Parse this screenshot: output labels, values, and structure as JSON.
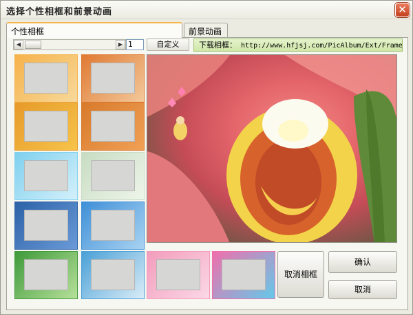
{
  "window": {
    "title": "选择个性相框和前景动画",
    "close_glyph": "✕"
  },
  "tabs": [
    {
      "label": "个性相框"
    },
    {
      "label": "前景动画"
    }
  ],
  "toolbar": {
    "scroll_left_glyph": "◀",
    "scroll_right_glyph": "▶",
    "page_value": "1",
    "custom_label": "自定义",
    "download_label": "下载相框：",
    "download_url": "http://www.hfjsj.com/PicAlbum/Ext/Frame.htm"
  },
  "thumbnails": [
    {
      "name": "orange-floral-frame",
      "border": "#f6b24a",
      "inner": "#f7d99b"
    },
    {
      "name": "orange-cartoon-frame",
      "border": "#e07a33",
      "inner": "#f3c89a"
    },
    {
      "name": "autumn-leaves-frame",
      "border": "#e69a2a",
      "inner": "#f7c44a"
    },
    {
      "name": "autumn-tree-frame",
      "border": "#d87a2c",
      "inner": "#f0a055"
    },
    {
      "name": "light-blue-frame",
      "border": "#7fd0ee",
      "inner": "#d4f0fb"
    },
    {
      "name": "birthday-kids-frame",
      "border": "#c7dcc2",
      "inner": "#eef5ea"
    },
    {
      "name": "night-sky-frame",
      "border": "#2d62a8",
      "inner": "#6a9ad7"
    },
    {
      "name": "blue-sky-frame",
      "border": "#3f8fd7",
      "inner": "#a8d3f2"
    },
    {
      "name": "green-garden-frame",
      "border": "#3e9a3a",
      "inner": "#b7e09a"
    },
    {
      "name": "windmill-frame",
      "border": "#4aa0d7",
      "inner": "#d9ecf7"
    },
    {
      "name": "pink-lace-frame",
      "border": "#f39cbc",
      "inner": "#fbd8e6"
    },
    {
      "name": "pink-cartoon-frame",
      "border": "#f06fab",
      "inner": "#63c9ea"
    }
  ],
  "buttons": {
    "cancel_frame": "取消相框",
    "ok": "确认",
    "cancel": "取消"
  }
}
